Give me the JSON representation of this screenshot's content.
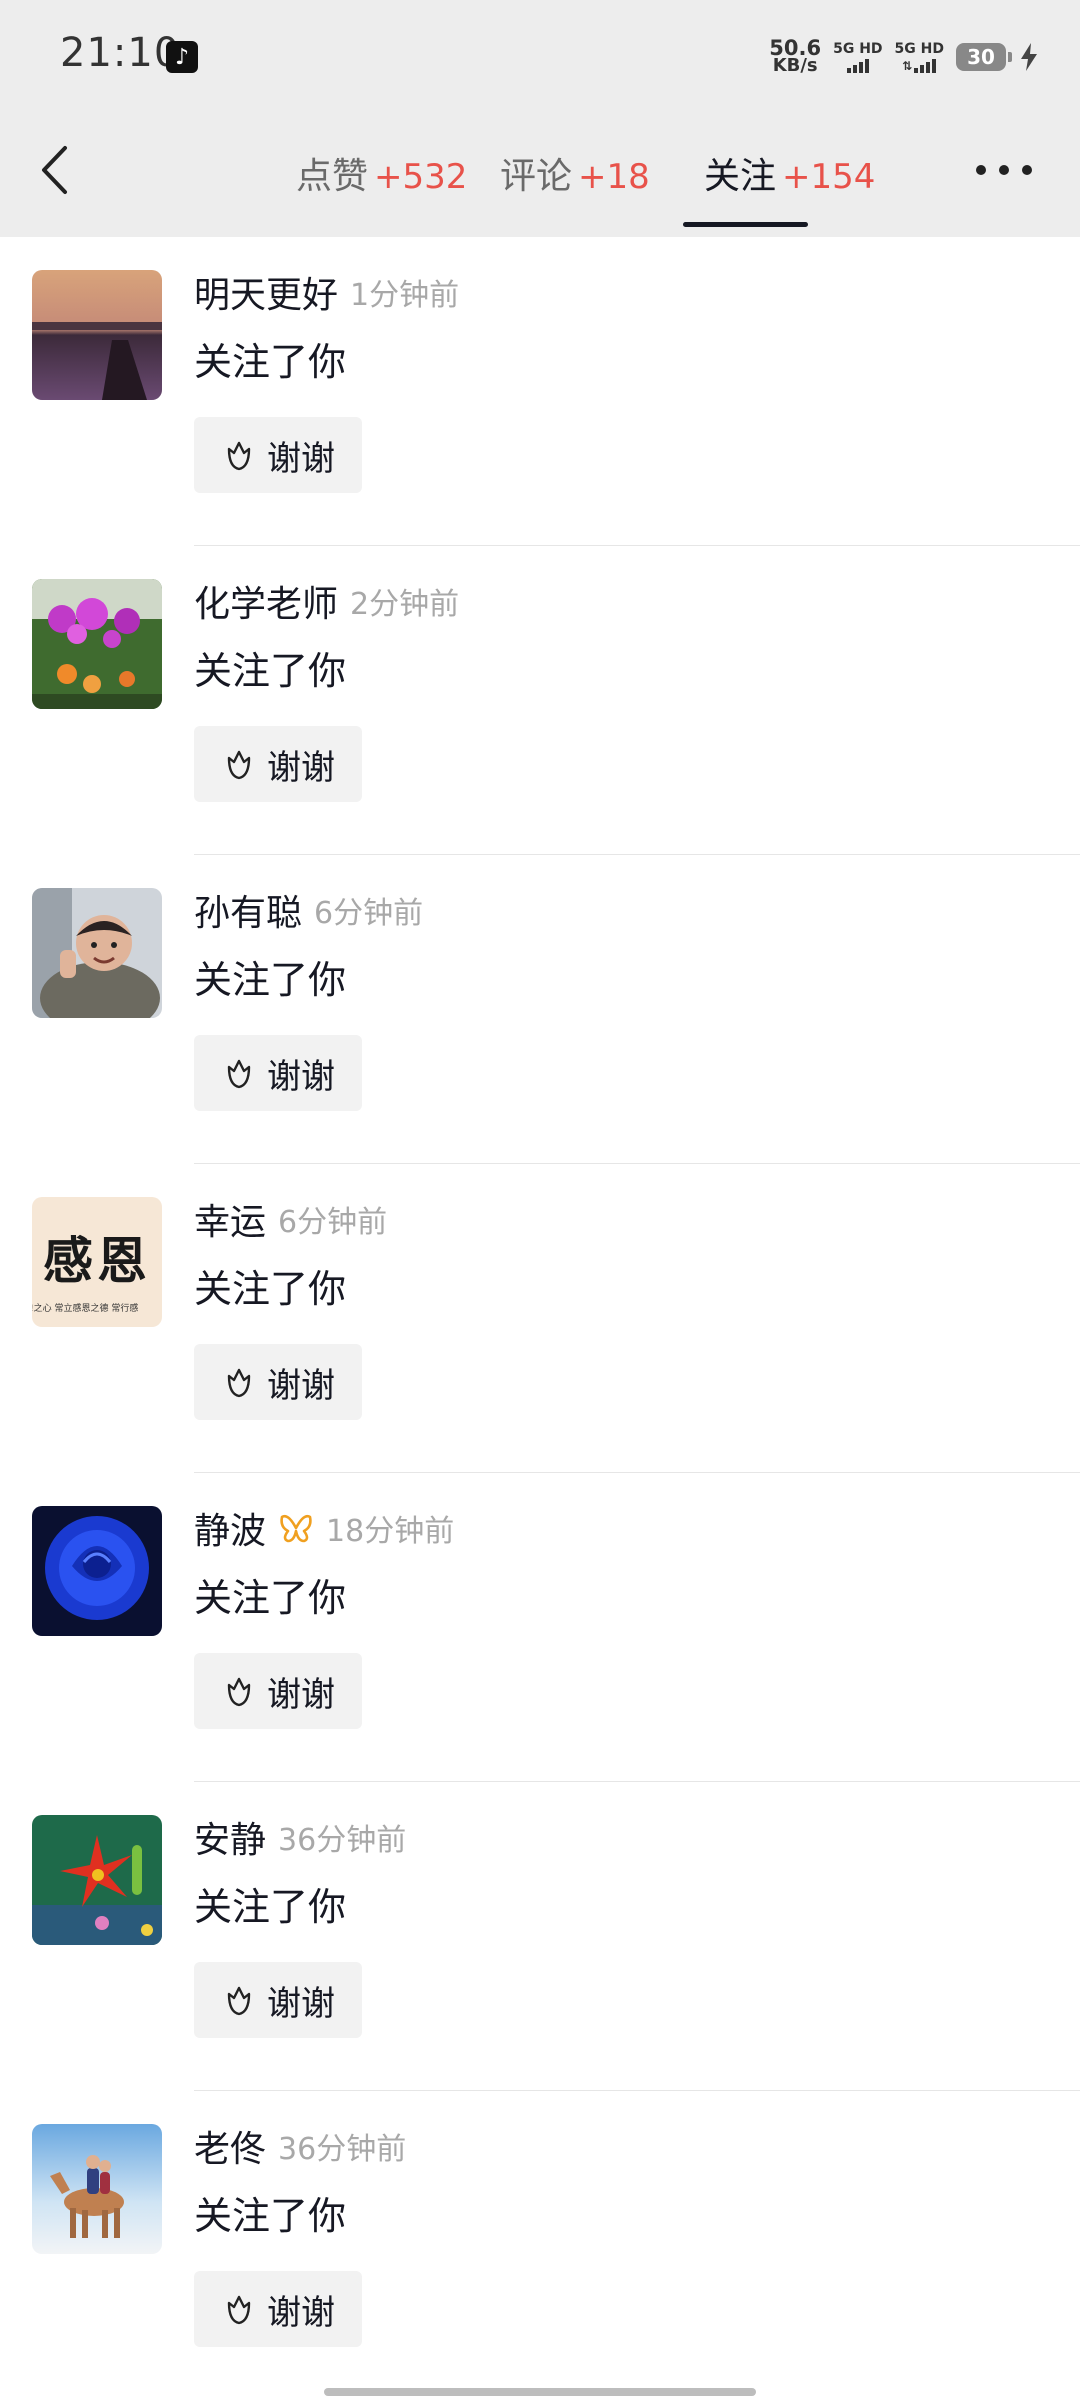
{
  "status_bar": {
    "time": "21:10",
    "net_speed_value": "50.6",
    "net_speed_unit": "KB/s",
    "sim1_label": "5G HD",
    "sim2_label": "5G HD",
    "battery": "30"
  },
  "header": {
    "tabs": [
      {
        "label": "点赞",
        "count": "+532"
      },
      {
        "label": "评论",
        "count": "+18"
      },
      {
        "label": "关注",
        "count": "+154"
      }
    ],
    "active_tab": "关注"
  },
  "colors": {
    "accent_count": "#e8524a",
    "time_gray": "#a8a8a8",
    "button_bg": "#f2f2f2"
  },
  "notifications": [
    {
      "username": "明天更好",
      "time": "1分钟前",
      "action": "关注了你",
      "button": "谢谢",
      "avatar": "sunset-lake"
    },
    {
      "username": "化学老师",
      "time": "2分钟前",
      "action": "关注了你",
      "button": "谢谢",
      "avatar": "flowers"
    },
    {
      "username": "孙有聪",
      "time": "6分钟前",
      "action": "关注了你",
      "button": "谢谢",
      "avatar": "child-photo"
    },
    {
      "username": "幸运",
      "time": "6分钟前",
      "action": "关注了你",
      "button": "谢谢",
      "avatar": "calligraphy",
      "avatar_text": "感恩",
      "avatar_subtext": "!之心 常立感恩之德 常行感"
    },
    {
      "username": "静波",
      "time": "18分钟前",
      "action": "关注了你",
      "button": "谢谢",
      "avatar": "blue-rose",
      "has_badge": true
    },
    {
      "username": "安静",
      "time": "36分钟前",
      "action": "关注了你",
      "button": "谢谢",
      "avatar": "red-lily"
    },
    {
      "username": "老佟",
      "time": "36分钟前",
      "action": "关注了你",
      "button": "谢谢",
      "avatar": "horse-snow"
    }
  ]
}
